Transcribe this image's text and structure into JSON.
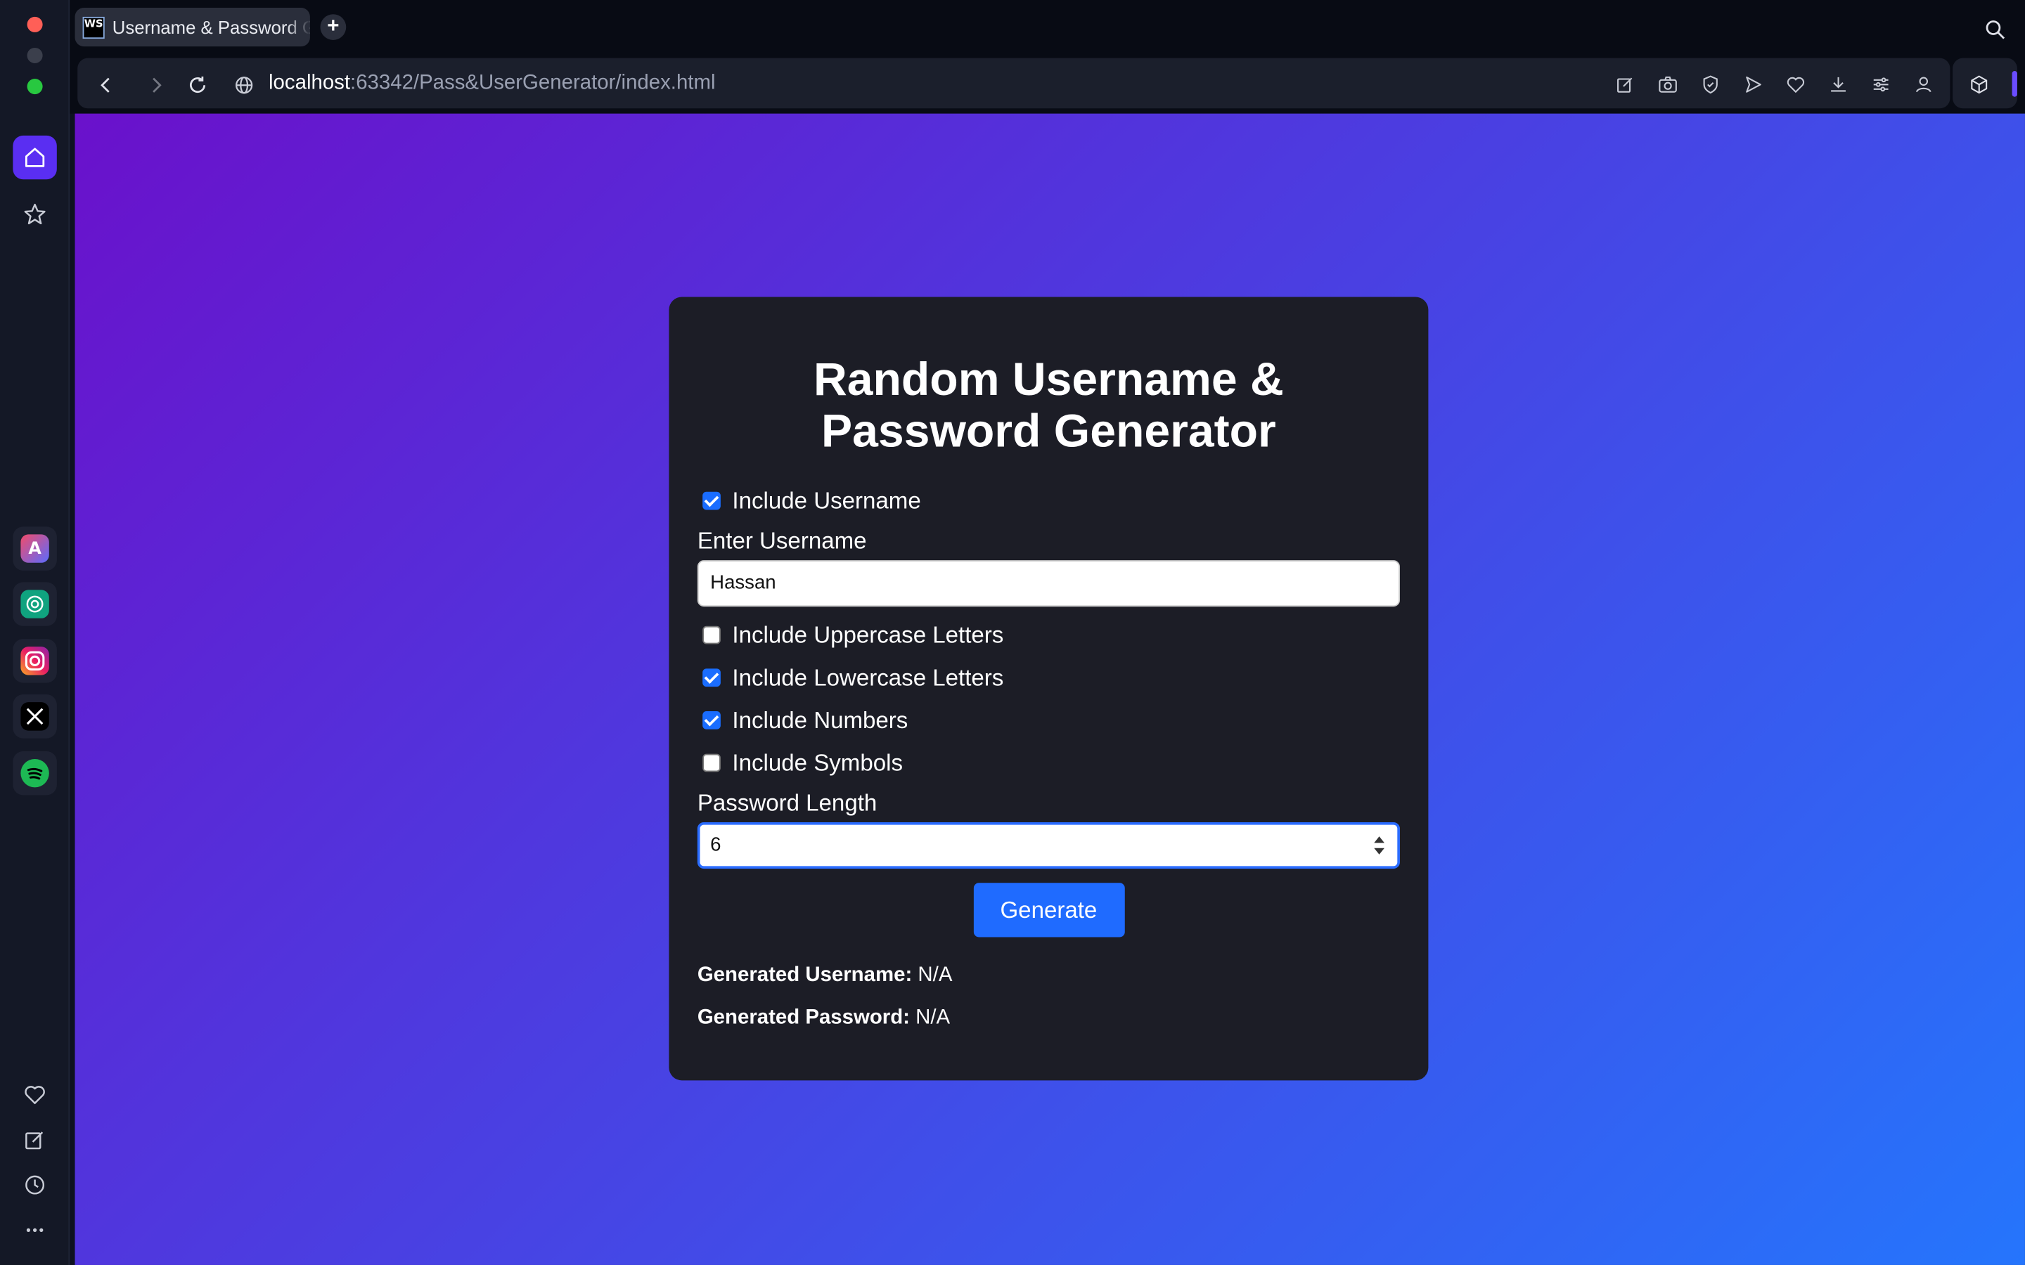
{
  "browser": {
    "tab_title": "Username & Password G",
    "tab_icon_text": "WS",
    "url_host": "localhost",
    "url_path": ":63342/Pass&UserGenerator/index.html"
  },
  "page": {
    "title": "Random Username & Password Generator",
    "options": {
      "include_username": {
        "label": "Include Username",
        "checked": true
      },
      "uppercase": {
        "label": "Include Uppercase Letters",
        "checked": false
      },
      "lowercase": {
        "label": "Include Lowercase Letters",
        "checked": true
      },
      "numbers": {
        "label": "Include Numbers",
        "checked": true
      },
      "symbols": {
        "label": "Include Symbols",
        "checked": false
      }
    },
    "username_label": "Enter Username",
    "username_value": "Hassan",
    "length_label": "Password Length",
    "length_value": "6",
    "generate_label": "Generate",
    "generated_username_label": "Generated Username:",
    "generated_username_value": "N/A",
    "generated_password_label": "Generated Password:",
    "generated_password_value": "N/A"
  },
  "colors": {
    "gradient_start": "#6a11cb",
    "gradient_end": "#2575fc",
    "card_bg": "#1c1d26",
    "accent": "#1f6bff"
  }
}
